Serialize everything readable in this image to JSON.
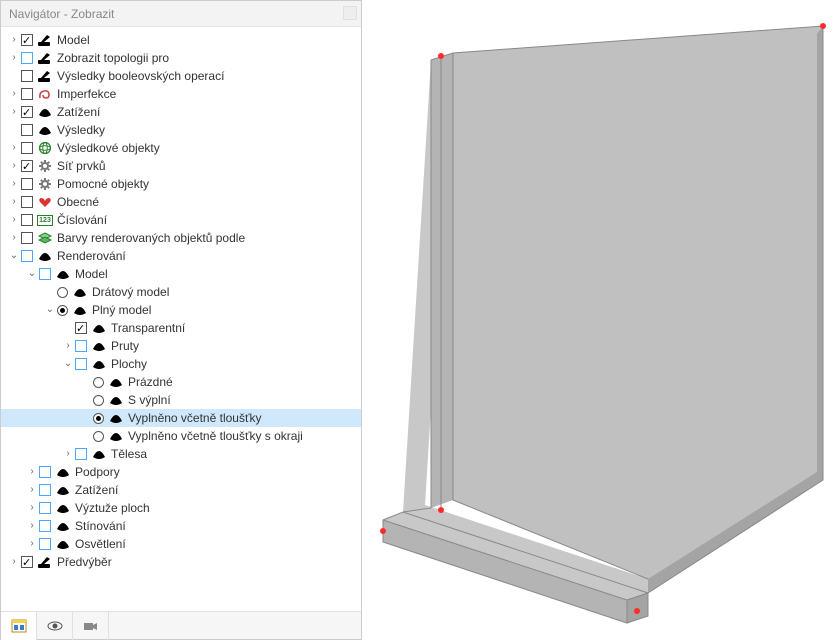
{
  "panel": {
    "title": "Navigátor - Zobrazit"
  },
  "tree": [
    {
      "id": "model",
      "depth": 0,
      "tog": "closed",
      "chk": "checkbox",
      "checked": true,
      "icon": "brush",
      "label": "Model"
    },
    {
      "id": "topo",
      "depth": 0,
      "tog": "closed",
      "chk": "checkbox",
      "checked": false,
      "chkBlue": true,
      "icon": "brush",
      "label": "Zobrazit topologii pro"
    },
    {
      "id": "bool",
      "depth": 0,
      "tog": "none",
      "chk": "checkbox",
      "checked": false,
      "icon": "brush",
      "label": "Výsledky booleovských operací"
    },
    {
      "id": "imperf",
      "depth": 0,
      "tog": "closed",
      "chk": "checkbox",
      "checked": false,
      "icon": "spiral",
      "label": "Imperfekce"
    },
    {
      "id": "zat",
      "depth": 0,
      "tog": "closed",
      "chk": "checkbox",
      "checked": true,
      "icon": "hat",
      "label": "Zatížení"
    },
    {
      "id": "vys",
      "depth": 0,
      "tog": "none",
      "chk": "checkbox",
      "checked": false,
      "icon": "hat",
      "label": "Výsledky"
    },
    {
      "id": "vysobj",
      "depth": 0,
      "tog": "closed",
      "chk": "checkbox",
      "checked": false,
      "icon": "globe",
      "label": "Výsledkové objekty"
    },
    {
      "id": "sit",
      "depth": 0,
      "tog": "closed",
      "chk": "checkbox",
      "checked": true,
      "icon": "gear",
      "label": "Síť prvků"
    },
    {
      "id": "pom",
      "depth": 0,
      "tog": "closed",
      "chk": "checkbox",
      "checked": false,
      "icon": "gear",
      "label": "Pomocné objekty"
    },
    {
      "id": "obec",
      "depth": 0,
      "tog": "closed",
      "chk": "checkbox",
      "checked": false,
      "icon": "heart",
      "label": "Obecné"
    },
    {
      "id": "cis",
      "depth": 0,
      "tog": "closed",
      "chk": "checkbox",
      "checked": false,
      "icon": "num",
      "label": "Číslování"
    },
    {
      "id": "barvy",
      "depth": 0,
      "tog": "closed",
      "chk": "checkbox",
      "checked": false,
      "icon": "layers",
      "label": "Barvy renderovaných objektů podle"
    },
    {
      "id": "rend",
      "depth": 0,
      "tog": "open",
      "chk": "checkbox",
      "checked": false,
      "chkBlue": true,
      "icon": "hat",
      "label": "Renderování"
    },
    {
      "id": "rmodel",
      "depth": 1,
      "tog": "open",
      "chk": "checkbox",
      "checked": false,
      "chkBlue": true,
      "icon": "hat",
      "label": "Model"
    },
    {
      "id": "drato",
      "depth": 2,
      "tog": "none",
      "chk": "radio",
      "checked": false,
      "icon": "hat",
      "label": "Drátový model"
    },
    {
      "id": "plny",
      "depth": 2,
      "tog": "open",
      "chk": "radio",
      "checked": true,
      "icon": "hat",
      "label": "Plný model"
    },
    {
      "id": "trans",
      "depth": 3,
      "tog": "none",
      "chk": "checkbox",
      "checked": true,
      "icon": "hat",
      "label": "Transparentní"
    },
    {
      "id": "pruty",
      "depth": 3,
      "tog": "closed",
      "chk": "checkbox",
      "checked": false,
      "chkBlue": true,
      "icon": "hat",
      "label": "Pruty"
    },
    {
      "id": "plochy",
      "depth": 3,
      "tog": "open",
      "chk": "checkbox",
      "checked": false,
      "chkBlue": true,
      "icon": "hat",
      "label": "Plochy"
    },
    {
      "id": "prazdne",
      "depth": 4,
      "tog": "none",
      "chk": "radio",
      "checked": false,
      "icon": "hat",
      "label": "Prázdné"
    },
    {
      "id": "svypln",
      "depth": 4,
      "tog": "none",
      "chk": "radio",
      "checked": false,
      "icon": "hat",
      "label": "S výplní"
    },
    {
      "id": "vyplt",
      "depth": 4,
      "tog": "none",
      "chk": "radio",
      "checked": true,
      "icon": "hat",
      "label": "Vyplněno včetně tloušťky",
      "selected": true
    },
    {
      "id": "vyplto",
      "depth": 4,
      "tog": "none",
      "chk": "radio",
      "checked": false,
      "icon": "hat",
      "label": "Vyplněno včetně tloušťky s okraji"
    },
    {
      "id": "telesa",
      "depth": 3,
      "tog": "closed",
      "chk": "checkbox",
      "checked": false,
      "chkBlue": true,
      "icon": "hat",
      "label": "Tělesa"
    },
    {
      "id": "podpory",
      "depth": 1,
      "tog": "closed",
      "chk": "checkbox",
      "checked": false,
      "chkBlue": true,
      "icon": "hat",
      "label": "Podpory"
    },
    {
      "id": "zat2",
      "depth": 1,
      "tog": "closed",
      "chk": "checkbox",
      "checked": false,
      "chkBlue": true,
      "icon": "hat",
      "label": "Zatížení"
    },
    {
      "id": "vyzt",
      "depth": 1,
      "tog": "closed",
      "chk": "checkbox",
      "checked": false,
      "chkBlue": true,
      "icon": "hat",
      "label": "Výztuže ploch"
    },
    {
      "id": "stin",
      "depth": 1,
      "tog": "closed",
      "chk": "checkbox",
      "checked": false,
      "chkBlue": true,
      "icon": "hat",
      "label": "Stínování"
    },
    {
      "id": "osvet",
      "depth": 1,
      "tog": "closed",
      "chk": "checkbox",
      "checked": false,
      "chkBlue": true,
      "icon": "hat",
      "label": "Osvětlení"
    },
    {
      "id": "predvyber",
      "depth": 0,
      "tog": "closed",
      "chk": "checkbox",
      "checked": true,
      "icon": "brush",
      "label": "Předvýběr"
    }
  ],
  "bottomTabs": [
    "layout",
    "eye",
    "camera"
  ]
}
